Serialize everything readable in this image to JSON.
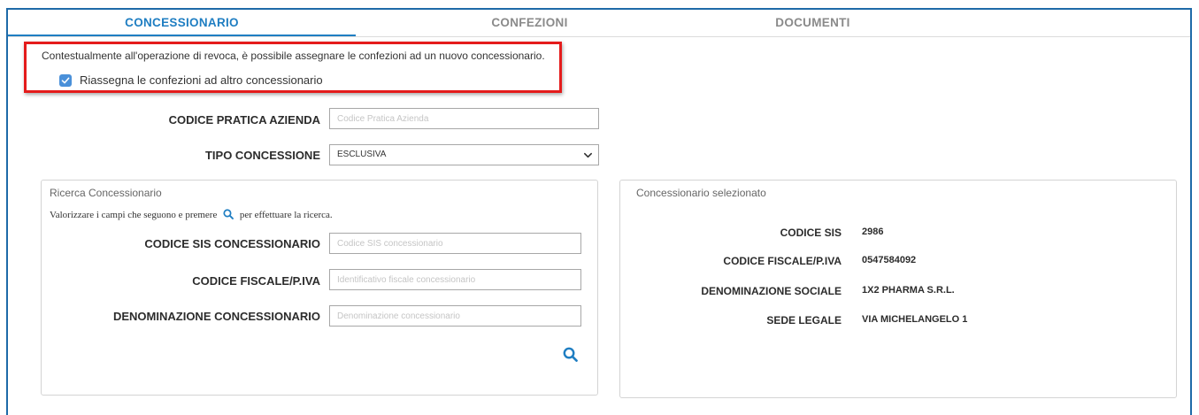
{
  "tabs": [
    {
      "label": "CONCESSIONARIO",
      "active": true
    },
    {
      "label": "CONFEZIONI",
      "active": false
    },
    {
      "label": "DOCUMENTI",
      "active": false
    }
  ],
  "notice": {
    "text": "Contestualmente all'operazione di revoca, è possibile assegnare le confezioni ad un nuovo concessionario.",
    "checkbox_label": "Riassegna le confezioni ad altro concessionario",
    "checkbox_checked": true
  },
  "form": {
    "codice_pratica_label": "CODICE PRATICA AZIENDA",
    "codice_pratica_placeholder": "Codice Pratica Azienda",
    "codice_pratica_value": "",
    "tipo_concessione_label": "TIPO CONCESSIONE",
    "tipo_concessione_value": "ESCLUSIVA"
  },
  "search_panel": {
    "title": "Ricerca Concessionario",
    "hint_before": "Valorizzare i campi che seguono e premere",
    "hint_after": "per effettuare la ricerca.",
    "fields": [
      {
        "label": "CODICE SIS CONCESSIONARIO",
        "placeholder": "Codice SIS concessionario",
        "value": ""
      },
      {
        "label": "CODICE FISCALE/P.IVA",
        "placeholder": "Identificativo fiscale concessionario",
        "value": ""
      },
      {
        "label": "DENOMINAZIONE CONCESSIONARIO",
        "placeholder": "Denominazione concessionario",
        "value": ""
      }
    ],
    "search_icon": "search-icon"
  },
  "selected_panel": {
    "title": "Concessionario selezionato",
    "rows": [
      {
        "label": "CODICE SIS",
        "value": "2986"
      },
      {
        "label": "CODICE FISCALE/P.IVA",
        "value": "0547584092"
      },
      {
        "label": "DENOMINAZIONE SOCIALE",
        "value": "1X2 PHARMA S.R.L."
      },
      {
        "label": "SEDE LEGALE",
        "value": "VIA MICHELANGELO 1"
      }
    ]
  },
  "colors": {
    "accent": "#1f7ec2",
    "highlight_border": "#e41b1b",
    "checkbox": "#4a90d9"
  }
}
